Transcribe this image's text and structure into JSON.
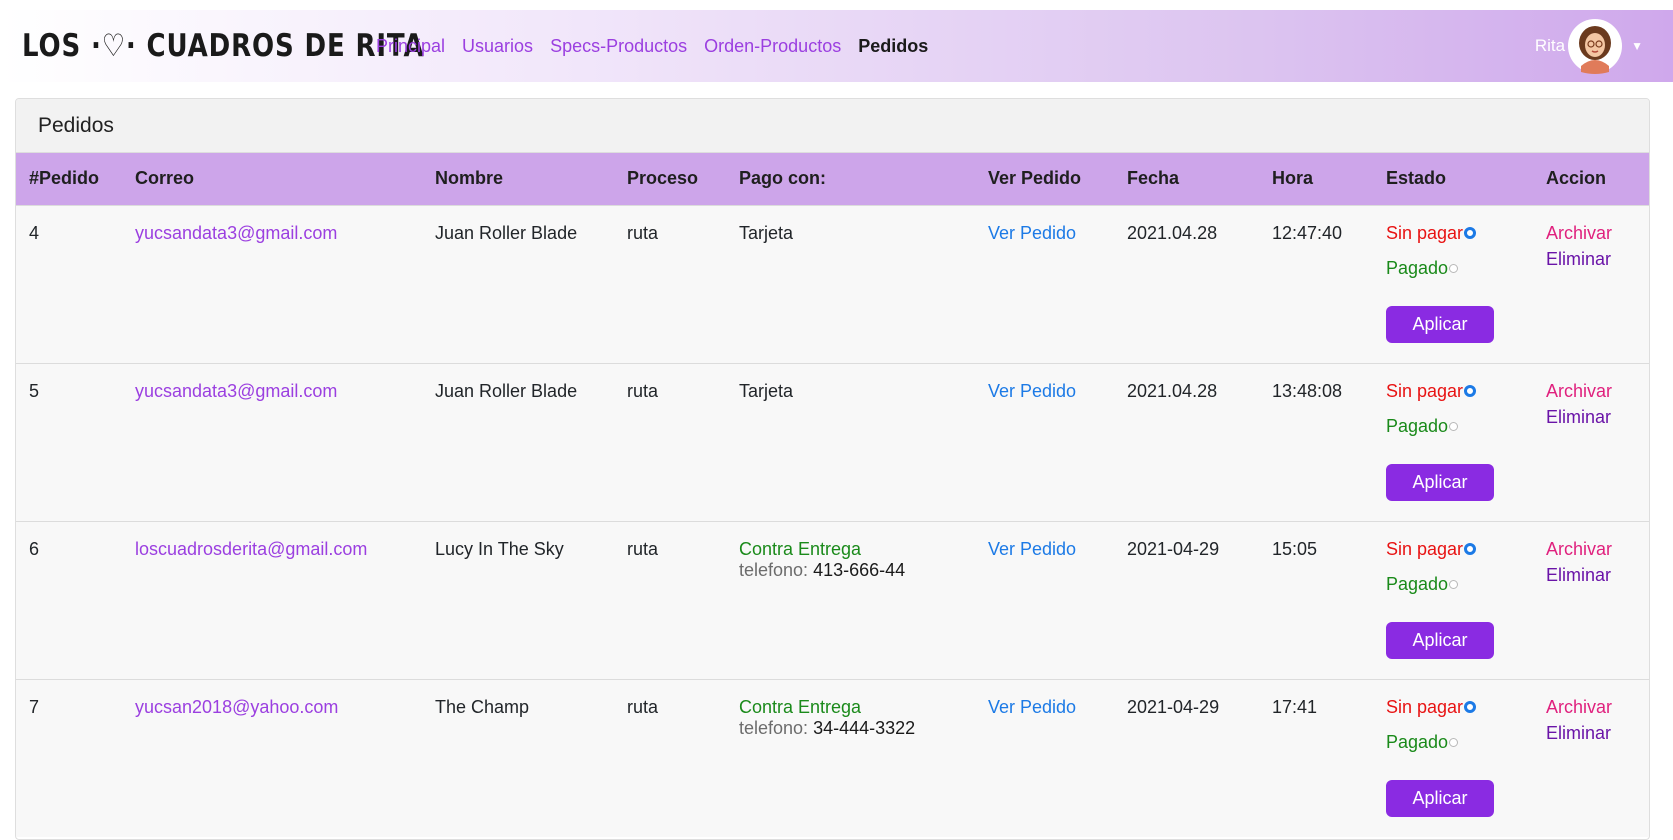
{
  "brand": "LOS ·♡· CUADROS DE RITA",
  "nav": [
    "Principal",
    "Usuarios",
    "Specs-Productos",
    "Orden-Productos",
    "Pedidos"
  ],
  "user": {
    "name": "Rita",
    "caret_icon": "caret-down-icon"
  },
  "card": {
    "title": "Pedidos",
    "headers": [
      "#Pedido",
      "Correo",
      "Nombre",
      "Proceso",
      "Pago con:",
      "Ver Pedido",
      "Fecha",
      "Hora",
      "Estado",
      "Accion"
    ],
    "labels": {
      "ver_pedido": "Ver Pedido",
      "sin_pagar": "Sin pagar",
      "pagado": "Pagado",
      "aplicar": "Aplicar",
      "archivar": "Archivar",
      "eliminar": "Eliminar",
      "telefono": "telefono:"
    },
    "rows": [
      {
        "id": "4",
        "email": "yucsandata3@gmail.com",
        "name": "Juan Roller Blade",
        "proceso": "ruta",
        "pago": "Tarjeta",
        "telefono": "",
        "fecha": "2021.04.28",
        "hora": "12:47:40",
        "estado": "Sin pagar"
      },
      {
        "id": "5",
        "email": "yucsandata3@gmail.com",
        "name": "Juan Roller Blade",
        "proceso": "ruta",
        "pago": "Tarjeta",
        "telefono": "",
        "fecha": "2021.04.28",
        "hora": "13:48:08",
        "estado": "Sin pagar"
      },
      {
        "id": "6",
        "email": "loscuadrosderita@gmail.com",
        "name": "Lucy In The Sky",
        "proceso": "ruta",
        "pago": "Contra Entrega",
        "telefono": "413-666-44",
        "fecha": "2021-04-29",
        "hora": "15:05",
        "estado": "Sin pagar"
      },
      {
        "id": "7",
        "email": "yucsan2018@yahoo.com",
        "name": "The Champ",
        "proceso": "ruta",
        "pago": "Contra Entrega",
        "telefono": "34-444-3322",
        "fecha": "2021-04-29",
        "hora": "17:41",
        "estado": "Sin pagar"
      }
    ]
  },
  "colors": {
    "accent": "#9b3fe0",
    "header_row": "#cda5ea",
    "button": "#8a2be2",
    "link_blue": "#1c7ae6",
    "sin_pagar": "#e81313",
    "pagado": "#1a8a1a",
    "archivar": "#e0217e",
    "eliminar": "#6a14a8"
  }
}
